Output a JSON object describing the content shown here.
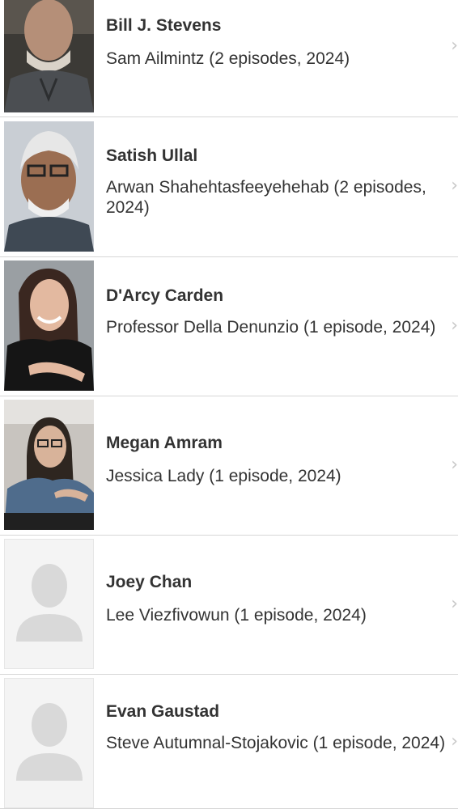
{
  "cast": [
    {
      "name": "Bill J. Stevens",
      "role": "Sam Ailmintz (2 episodes, 2024)",
      "photo": "headshot-photo"
    },
    {
      "name": "Satish Ullal",
      "role": "Arwan Shahehtasfeeyehehab (2 episodes, 2024)",
      "photo": "headshot-photo"
    },
    {
      "name": "D'Arcy Carden",
      "role": "Professor Della Denunzio (1 episode, 2024)",
      "photo": "headshot-photo"
    },
    {
      "name": "Megan Amram",
      "role": "Jessica Lady (1 episode, 2024)",
      "photo": "headshot-photo"
    },
    {
      "name": "Joey Chan",
      "role": "Lee Viezfivowun (1 episode, 2024)",
      "photo": "placeholder-silhouette"
    },
    {
      "name": "Evan Gaustad",
      "role": "Steve Autumnal-Stojakovic (1 episode, 2024)",
      "photo": "placeholder-silhouette"
    }
  ],
  "icons": {
    "chevron": "chevron-right-icon"
  },
  "colors": {
    "text": "#333333",
    "divider": "#d6d6d6",
    "chevron": "#c8c8c8"
  }
}
